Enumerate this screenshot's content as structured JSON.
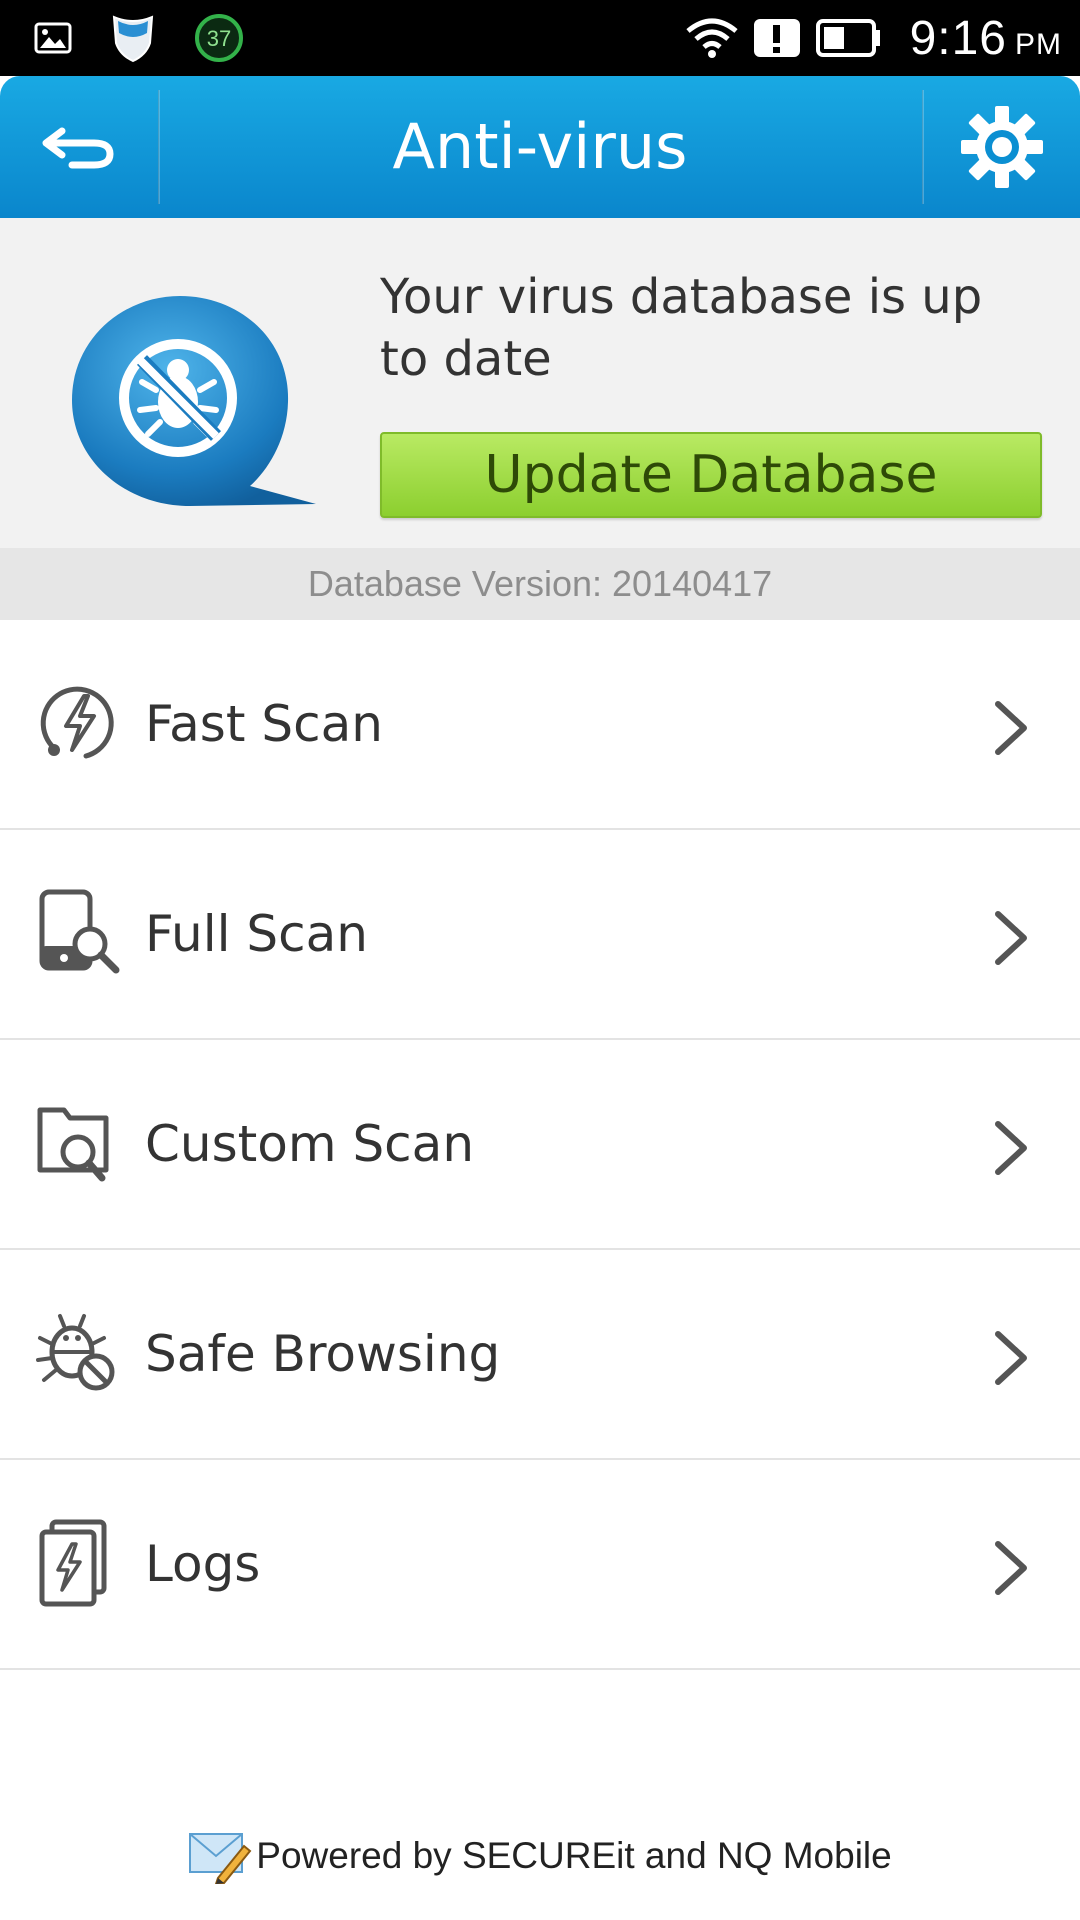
{
  "status_bar": {
    "notification_count": "37",
    "time": "9:16",
    "ampm": "PM",
    "icons": [
      "image-notification-icon",
      "shield-app-icon",
      "counter-badge-icon",
      "wifi-icon",
      "alert-icon",
      "battery-icon"
    ]
  },
  "header": {
    "title": "Anti-virus",
    "back_icon": "back-arrow-icon",
    "settings_icon": "gear-icon",
    "color": "#0a97d8"
  },
  "database": {
    "status_text": "Your virus database is up to date",
    "update_button_label": "Update Database",
    "version_text": "Database Version: 20140417",
    "logo_icon": "virus-blocked-icon",
    "accent_color": "#8ccf2f"
  },
  "menu": {
    "items": [
      {
        "label": "Fast Scan",
        "icon": "fast-scan-icon"
      },
      {
        "label": "Full Scan",
        "icon": "full-scan-icon"
      },
      {
        "label": "Custom Scan",
        "icon": "custom-scan-icon"
      },
      {
        "label": "Safe Browsing",
        "icon": "safe-browsing-icon"
      },
      {
        "label": "Logs",
        "icon": "logs-icon"
      }
    ]
  },
  "footer": {
    "text": "Powered by SECUREit and NQ Mobile",
    "icon": "mail-pencil-icon"
  }
}
